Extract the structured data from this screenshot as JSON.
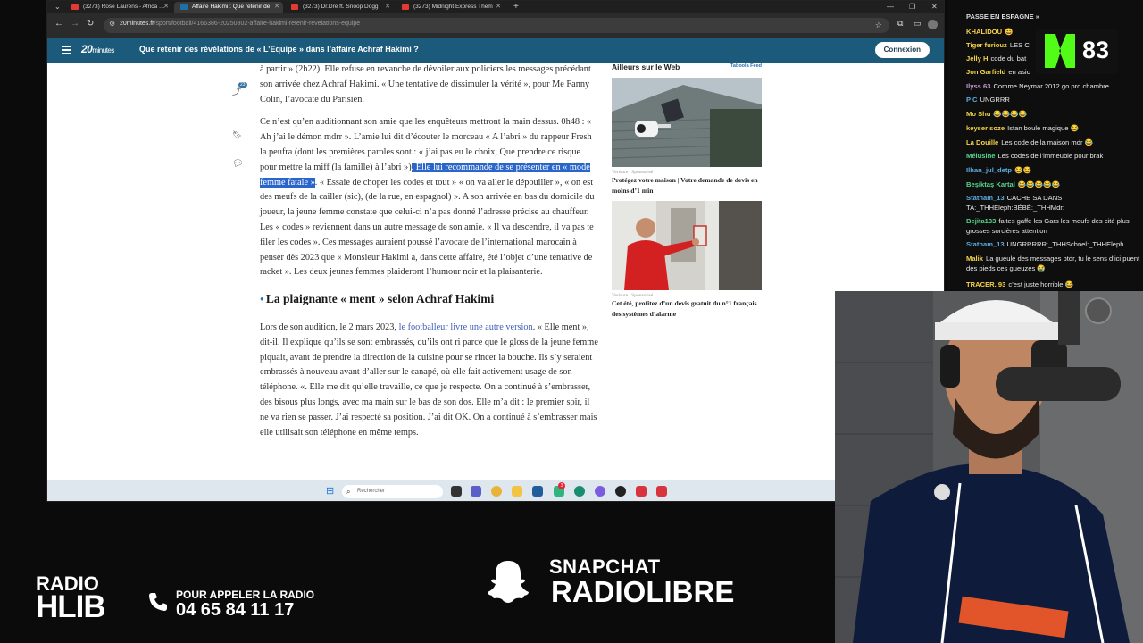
{
  "browser": {
    "tabs": [
      {
        "title": "(3273) Rose Laurens - Africa (O",
        "favicon_color": "#e53935",
        "active": false
      },
      {
        "title": "Affaire Hakimi : Que retenir de",
        "favicon_color": "#1f6fa8",
        "active": true
      },
      {
        "title": "(3273) Dr.Dre ft. Snoop Dogg",
        "favicon_color": "#e53935",
        "active": false
      },
      {
        "title": "(3273) Midnight Express Them",
        "favicon_color": "#e53935",
        "active": false
      }
    ],
    "new_tab": "+",
    "url_domain": "20minutes.fr",
    "url_path": "/sport/football/4166386-20250802-affaire-hakimi-retenir-revelations-equipe"
  },
  "site": {
    "logo_main": "20",
    "logo_sub": "minutes",
    "headline": "Que retenir des révélations de « L’Equipe » dans l’affaire Achraf Hakimi ?",
    "login_label": "Connexion",
    "share_count": "23"
  },
  "article": {
    "p1": "à partir » (2h22). Elle refuse en revanche de dévoiler aux policiers les messages précédant son arrivée chez Achraf Hakimi. « Une tentative de dissimuler la vérité », pour Me Fanny Colin, l’avocate du Parisien.",
    "p2_before": "Ce n’est qu’en auditionnant son amie que les enquêteurs mettront la main dessus. 0h48 : « Ah j’ai le démon mdrr ». L’amie lui dit d’écouter le morceau « A l’abri » du rappeur Fresh la peufra (dont les premières paroles sont : « j’ai pas eu le choix, Que prendre ce risque pour mettre la miff (la famille) à l’abri »)",
    "p2_selected": ". Elle lui recommande de se présenter en « mode femme fatale »",
    "p2_after": ". « Essaie de choper les codes et tout » « on va aller le dépouiller », « on est des meufs de la cailler (sic), (de la rue, en espagnol) ». A son arrivée en bas du domicile du joueur, la jeune femme constate que celui-ci n’a pas donné l’adresse précise au chauffeur. Les « codes » reviennent dans un autre message de son amie. « Il va descendre, il va pas te filer les codes ». Ces messages auraient poussé l’avocate de l’international marocain à penser dès 2023 que « Monsieur Hakimi a, dans cette affaire, été l’objet d’une tentative de racket ». Les deux jeunes femmes plaideront l’humour noir et la plaisanterie.",
    "h2": "La plaignante « ment » selon Achraf Hakimi",
    "p3_before": "Lors de son audition, le 2 mars 2023, ",
    "p3_link": "le footballeur livre une autre version",
    "p3_after": ". « Elle ment », dit-il. Il explique qu’ils se sont embrassés, qu’ils ont ri parce que le gloss de la jeune femme piquait, avant de prendre la direction de la cuisine pour se rincer la bouche. Ils s’y seraient embrassés à nouveau avant d’aller sur le canapé, où elle fait activement usage de son téléphone. «. Elle me dit qu’elle travaille, ce que je respecte. On a continué à s’embrasser, des bisous plus longs, avec ma main sur le bas de son dos. Elle m’a dit : le premier soir, il ne va rien se passer. J’ai respecté sa position. J’ai dit OK. On a continué à s’embrasser mais elle utilisait son téléphone en même temps."
  },
  "aside": {
    "heading": "Ailleurs sur le Web",
    "provider": "Taboola Feed",
    "ads": [
      {
        "source": "Verisure | Sponsorisé",
        "title": "Protégez votre maison | Votre demande de devis en moins d’1 min"
      },
      {
        "source": "Verisure | Sponsorisé",
        "title": "Cet été, profitez d’un devis gratuit du n°1 français des systèmes d’alarme"
      }
    ]
  },
  "taskbar": {
    "search_placeholder": "Rechercher",
    "badge": "3"
  },
  "chat": {
    "header": "PASSE EN ESPAGNE »",
    "viewer_count": "83",
    "messages": [
      {
        "user": "KHALIDOU",
        "text": "😄",
        "color": "#f3d34a"
      },
      {
        "user": "Tiger furiouz",
        "text": "LES C",
        "color": "#f3d34a"
      },
      {
        "user": "Jelly H",
        "text": "code du bat",
        "color": "#f3d34a"
      },
      {
        "user": "Jon Garfield",
        "text": "en asic",
        "color": "#f3d34a"
      },
      {
        "user": "Ilyss 63",
        "text": "Comme Neymar 2012 go pro chambre",
        "color": "#c39bd3"
      },
      {
        "user": "P C",
        "text": "UNGRRR",
        "color": "#5dade2"
      },
      {
        "user": "Mo Shu",
        "text": "😂😂😂😂",
        "color": "#f3d34a"
      },
      {
        "user": "keyser soze",
        "text": "Istan boule magique 😂",
        "color": "#f3d34a"
      },
      {
        "user": "La Douille",
        "text": "Les code de la maison mdr 😂",
        "color": "#f3d34a"
      },
      {
        "user": "Mélusine",
        "text": "Les codes de l’immeuble pour brak",
        "color": "#58d68d"
      },
      {
        "user": "Ilhan_jul_detp",
        "text": "😂😂",
        "color": "#5dade2"
      },
      {
        "user": "Beşiktaş Kartal",
        "text": "😂😂😂😂😂",
        "color": "#58d68d"
      },
      {
        "user": "Statham_13",
        "text": "CACHE SA DANS TA:_THHEleph:BÉBÉ:_THHMdr:",
        "color": "#5dade2"
      },
      {
        "user": "Bejita133",
        "text": "faites gaffe les Gars les meufs des cité plus grosses sorcières attention",
        "color": "#58d68d"
      },
      {
        "user": "Statham_13",
        "text": "UNGRRRRR:_THHSchnel:_THHEleph",
        "color": "#5dade2"
      },
      {
        "user": "Malik",
        "text": "La gueule des messages ptdr, tu le sens d’ici puent des pieds ces gueuzes 😭",
        "color": "#f3d34a"
      },
      {
        "user": "TRACER. 93",
        "text": "c’est juste horrible 😂",
        "color": "#f3d34a"
      }
    ]
  },
  "overlay": {
    "radio_line1": "RADIO",
    "radio_line2": "HLIB",
    "phone_label": "POUR APPELER LA RADIO",
    "phone_number": "04 65 84 11 17",
    "snap_line1": "SNAPCHAT",
    "snap_line2": "RADIOLIBRE"
  }
}
